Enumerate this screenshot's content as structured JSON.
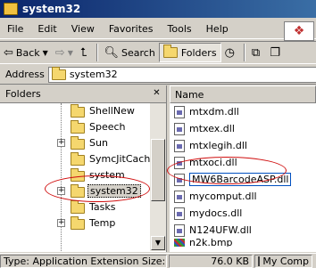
{
  "window": {
    "title": "system32"
  },
  "menu": [
    "File",
    "Edit",
    "View",
    "Favorites",
    "Tools",
    "Help"
  ],
  "toolbar": {
    "back_label": "Back",
    "search_label": "Search",
    "folders_label": "Folders"
  },
  "address": {
    "label": "Address",
    "value": "system32"
  },
  "folders_pane": {
    "title": "Folders",
    "items": [
      {
        "label": "ShellNew",
        "expander": ""
      },
      {
        "label": "Speech",
        "expander": ""
      },
      {
        "label": "Sun",
        "expander": "+"
      },
      {
        "label": "SymcJitCache",
        "expander": ""
      },
      {
        "label": "system",
        "expander": ""
      },
      {
        "label": "system32",
        "expander": "+",
        "selected": true
      },
      {
        "label": "Tasks",
        "expander": ""
      },
      {
        "label": "Temp",
        "expander": "+"
      }
    ]
  },
  "file_list": {
    "column_header": "Name",
    "files": [
      {
        "name": "mtxdm.dll"
      },
      {
        "name": "mtxex.dll"
      },
      {
        "name": "mtxlegih.dll"
      },
      {
        "name": "mtxoci.dll"
      },
      {
        "name": "MW6BarcodeASP.dll",
        "highlighted": true
      },
      {
        "name": "mycomput.dll"
      },
      {
        "name": "mydocs.dll"
      },
      {
        "name": "N124UFW.dll"
      },
      {
        "name": "n2k.bmp"
      }
    ]
  },
  "status": {
    "type_text": "Type: Application Extension Size: 76.0 KB",
    "size_text": "76.0 KB",
    "location_text": "My Comp"
  },
  "colors": {
    "annotation": "#d01010",
    "titlebar": "#0a246a"
  }
}
